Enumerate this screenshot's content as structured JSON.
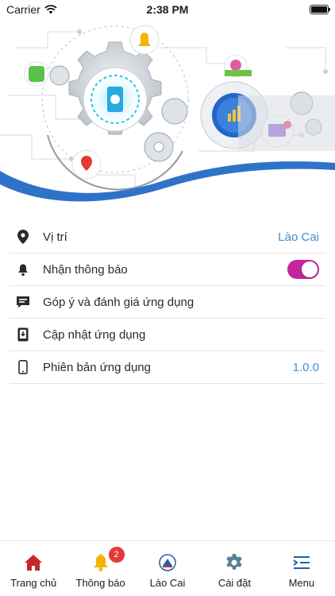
{
  "status": {
    "carrier": "Carrier",
    "time": "2:38 PM"
  },
  "settings": {
    "items": [
      {
        "label": "Vị trí",
        "value": "Lào Cai",
        "icon": "location-pin-icon"
      },
      {
        "label": "Nhận thông báo",
        "toggle_on": true,
        "icon": "bell-icon"
      },
      {
        "label": "Góp ý và đánh giá ứng dụng",
        "icon": "feedback-icon"
      },
      {
        "label": "Cập nhật ứng dụng",
        "icon": "update-icon"
      },
      {
        "label": "Phiên bản ứng dụng",
        "value": "1.0.0",
        "icon": "phone-icon"
      }
    ]
  },
  "tabbar": {
    "tabs": [
      {
        "label": "Trang chủ",
        "icon": "home-icon"
      },
      {
        "label": "Thông báo",
        "icon": "bell-icon",
        "badge": "2"
      },
      {
        "label": "Lào Cai",
        "icon": "province-logo-icon"
      },
      {
        "label": "Cài đặt",
        "icon": "gear-icon"
      },
      {
        "label": "Menu",
        "icon": "menu-icon"
      }
    ]
  },
  "colors": {
    "accent": "#3a8fd6",
    "toggle": "#c2279e",
    "wave": "#2f73c9",
    "home_icon": "#c62828",
    "bell_icon": "#f5b400",
    "badge": "#e53935",
    "menu_icon": "#1f5fae"
  }
}
